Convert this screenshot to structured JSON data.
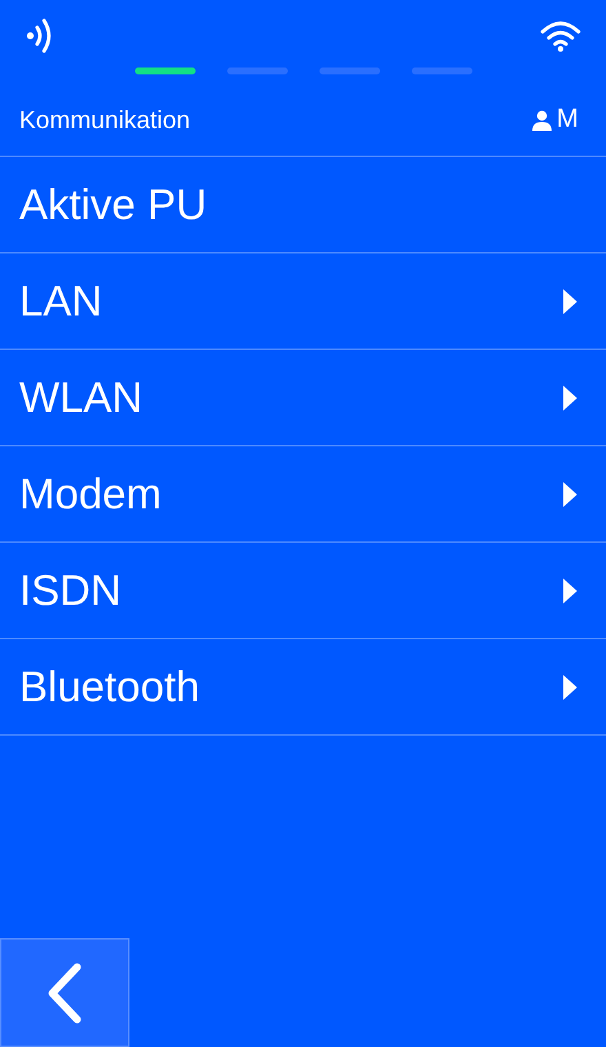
{
  "pager": [
    {
      "selected": true
    },
    {
      "selected": false
    },
    {
      "selected": false
    },
    {
      "selected": false
    }
  ],
  "header": {
    "title": "Kommunikation",
    "user": "M"
  },
  "items": [
    {
      "label": "Aktive PU",
      "has_submenu": false
    },
    {
      "label": "LAN",
      "has_submenu": true
    },
    {
      "label": "WLAN",
      "has_submenu": true
    },
    {
      "label": "Modem",
      "has_submenu": true
    },
    {
      "label": "ISDN",
      "has_submenu": true
    },
    {
      "label": "Bluetooth",
      "has_submenu": true
    }
  ]
}
